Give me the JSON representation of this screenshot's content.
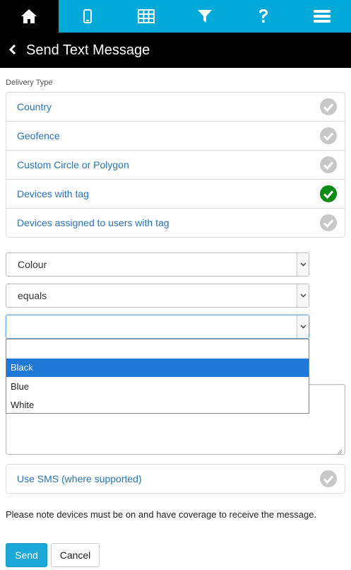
{
  "nav": {
    "items": [
      {
        "icon": "home-icon",
        "active": true
      },
      {
        "icon": "mobile-icon",
        "active": false
      },
      {
        "icon": "grid-icon",
        "active": false
      },
      {
        "icon": "filter-icon",
        "active": false
      },
      {
        "icon": "help-icon",
        "active": false
      },
      {
        "icon": "menu-icon",
        "active": false
      }
    ]
  },
  "header": {
    "title": "Send Text Message"
  },
  "delivery": {
    "label": "Delivery Type",
    "options": [
      {
        "label": "Country",
        "checked": false
      },
      {
        "label": "Geofence",
        "checked": false
      },
      {
        "label": "Custom Circle or Polygon",
        "checked": false
      },
      {
        "label": "Devices with tag",
        "checked": true
      },
      {
        "label": "Devices assigned to users with tag",
        "checked": false
      }
    ]
  },
  "filter": {
    "field": "Colour",
    "operator": "equals",
    "value": ""
  },
  "dropdown": {
    "options": [
      "",
      "Black",
      "Blue",
      "White"
    ],
    "highlighted_index": 1
  },
  "message": {
    "value": ""
  },
  "sms": {
    "label": "Use SMS (where supported)",
    "checked": false
  },
  "note": "Please note devices must be on and have coverage to receive the message.",
  "buttons": {
    "send": "Send",
    "cancel": "Cancel"
  },
  "colors": {
    "nav": "#00a9d8",
    "link": "#2a73b6",
    "check_on": "#0e8a16",
    "check_off": "#c8c8c8",
    "highlight": "#1e78d7"
  }
}
